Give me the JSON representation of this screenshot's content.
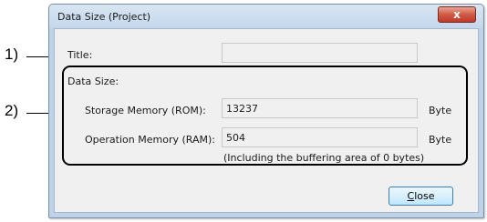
{
  "callouts": {
    "one": "1)",
    "two": "2)"
  },
  "dialog": {
    "title": "Data Size (Project)",
    "close_glyph": "x"
  },
  "form": {
    "title_label": "Title:",
    "title_value": "",
    "data_size_label": "Data Size:",
    "rom_label": "Storage Memory (ROM):",
    "rom_value": "13237",
    "rom_unit": "Byte",
    "ram_label": "Operation Memory (RAM):",
    "ram_value": "504",
    "ram_unit": "Byte",
    "ram_note": "(Including the buffering area of 0 bytes)"
  },
  "buttons": {
    "close_mnemonic": "C",
    "close_rest": "lose"
  },
  "colors": {
    "accent": "#3c7fb1",
    "close_red": "#c0392b",
    "frame": "#bfd3e8"
  }
}
